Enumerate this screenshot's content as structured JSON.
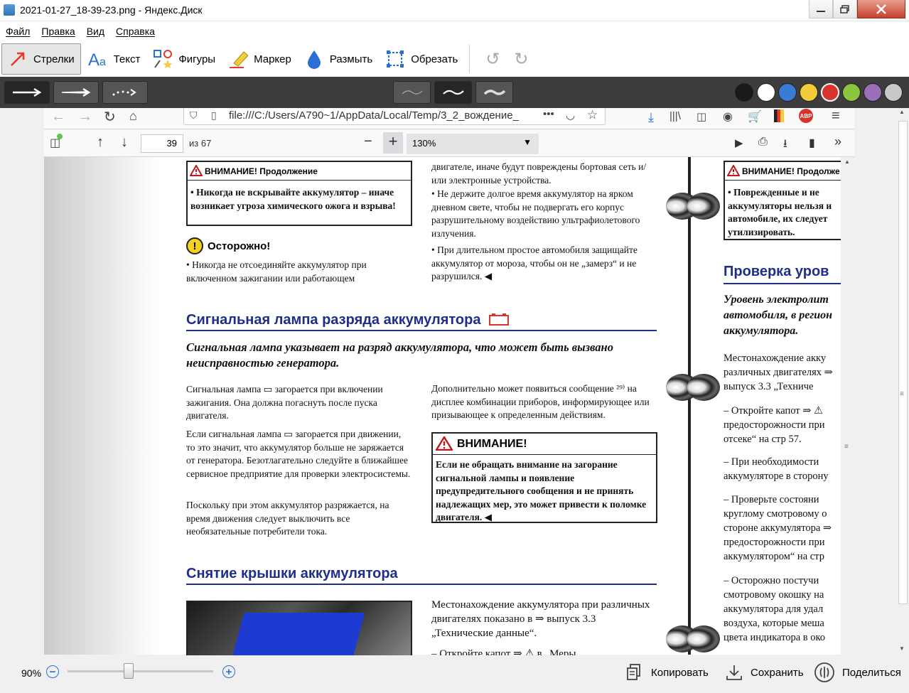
{
  "window": {
    "title": "2021-01-27_18-39-23.png - Яндекс.Диск",
    "accent": "#c6412b"
  },
  "menu": [
    "Файл",
    "Правка",
    "Вид",
    "Справка"
  ],
  "toolbar": {
    "tools": [
      {
        "label": "Стрелки",
        "icon": "arrow-icon",
        "active": true
      },
      {
        "label": "Текст",
        "icon": "text-icon"
      },
      {
        "label": "Фигуры",
        "icon": "shapes-icon"
      },
      {
        "label": "Маркер",
        "icon": "marker-icon"
      },
      {
        "label": "Размыть",
        "icon": "blur-icon"
      },
      {
        "label": "Обрезать",
        "icon": "crop-icon"
      }
    ]
  },
  "colors": [
    "#1a1a1a",
    "#ffffff",
    "#3a7bd5",
    "#f2cc3a",
    "#d9342b",
    "#8cc63f",
    "#9b6fb8",
    "#c8c8c8"
  ],
  "browser": {
    "url": "file:///C:/Users/A790~1/AppData/Local/Temp/3_2_вождение_",
    "page_current": "39",
    "page_total": "из 67",
    "zoom": "130%"
  },
  "doc": {
    "warn_cont_title": "ВНИМАНИЕ! Продолжение",
    "warn_cont_text": "•  Никогда не вскрывайте аккумулятор – иначе возникает угроза химического ожога и взрыва!",
    "caution_title": "Осторожно!",
    "caution_text": "•   Никогда не отсоединяйте аккумулятор при включенном зажигании или работающем",
    "col2_top": "двигателе, иначе будут повреждены бортовая сеть и/или электронные устройства.",
    "col2_b1": "•   Не держите долгое время аккумулятор на ярком дневном свете, чтобы не подвергать его корпус разрушительному воздействию ультрафиолетового излучения.",
    "col2_b2": "•   При длительном простое автомобиля защищайте аккумулятор от мороза, чтобы он не „замерз“ и не разрушился. ◀",
    "h_lamp": "Сигнальная лампа разряда аккумулятора",
    "lamp_intro": "Сигнальная лампа указывает на разряд аккумулятора, что может быть вызвано неисправностью генератора.",
    "p1": "Сигнальная лампа ▭ загорается при включении зажигания. Она должна погаснуть после пуска двигателя.",
    "p2": "Если сигнальная лампа ▭ загорается при движении, то это значит, что аккумулятор больше не заряжается от генератора. Безотлагательно следуйте в ближайшее сервисное предприятие для проверки электросистемы.",
    "p3": "Поскольку при этом аккумулятор разряжается, на время движения следует выключить все необязательные потребители тока.",
    "p4": "Дополнительно может появиться сообщение ²⁹⁾ на дисплее комбинации приборов, информирующее или призывающее к определенным действиям.",
    "warn_title": "ВНИМАНИЕ!",
    "warn_text": "Если не обращать внимание на загорание сигнальной лампы и появление предупредительного сообщения и не принять надлежащих мер, это может привести к поломке двигателя. ◀",
    "h_cover": "Снятие крышки аккумулятора",
    "p5": "Местонахождение аккумулятора при различных двигателях показано в ⇒ выпуск 3.3 „Технические данные“.",
    "p6": "– Откройте капот ⇒ ⚠ в „Меры",
    "r_warn_title": "ВНИМАНИЕ! Продолже",
    "r_warn_text": "•  Поврежденные и не аккумуляторы нельзя и автомобиле, их следует утилизировать.",
    "h_check": "Проверка уров",
    "r_intro": "Уровень электролит автомобиля, в регион аккумулятора.",
    "r_p1": "Местонахождение акку различных двигателях ⇒ выпуск 3.3 „Техниче",
    "r_p2": "– Откройте капот ⇒ ⚠ предосторожности при отсеке“ на стр 57.",
    "r_p3": "– При необходимости аккумуляторе в сторону",
    "r_p4": "– Проверьте состояни круглому смотровому о стороне аккумулятора ⇒ предосторожности при аккумулятором“ на стр",
    "r_p5": "– Осторожно постучи смотровому окошку на аккумулятора для удал воздуха, которые меша цвета индикатора в око"
  },
  "statusbar": {
    "zoom": "90%",
    "zoom_level": 0.45,
    "copy": "Копировать",
    "save": "Сохранить",
    "share": "Поделиться"
  }
}
